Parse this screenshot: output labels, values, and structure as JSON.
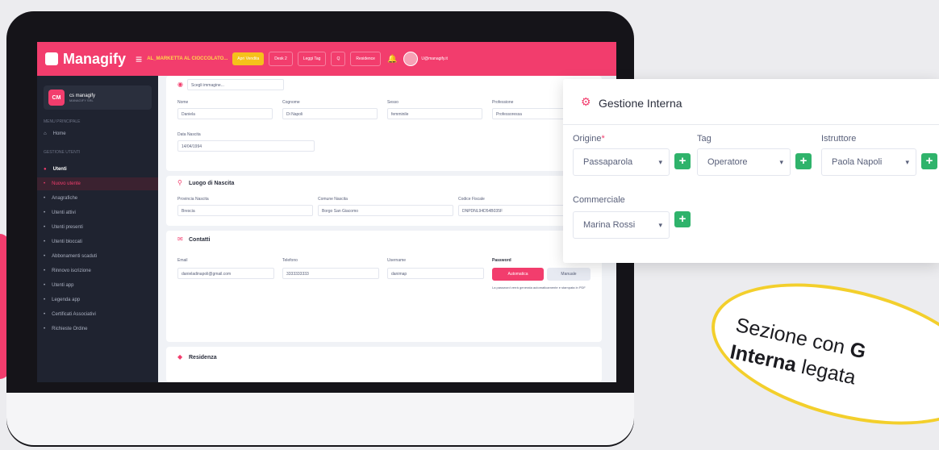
{
  "app": {
    "logo": "Managify",
    "breadcrumb": "AL_MARKETTA AL CIOCCOLATO...",
    "toolbar": [
      "Apri Vendita",
      "Desk 2",
      "Leggi Tag",
      "Q",
      "Residence"
    ],
    "user_label": "U@managify.it"
  },
  "sidebar": {
    "user": {
      "initials": "CM",
      "name": "cs managify",
      "sub": "MANAGIFY SRL"
    },
    "sections": [
      "MENU PRINCIPALE",
      "GESTIONE UTENTI"
    ],
    "home": "Home",
    "group": "Utenti",
    "items": [
      "Nuovo utente",
      "Anagrafiche",
      "Utenti attivi",
      "Utenti presenti",
      "Utenti bloccati",
      "Abbonamenti scaduti",
      "Rinnovo iscrizione",
      "Utenti app",
      "Legenda app",
      "Certificati Associativi",
      "Richieste Ordine"
    ]
  },
  "form": {
    "upload_label": "Scegli immagine...",
    "nome_label": "Nome",
    "nome_value": "Daniela",
    "cognome_label": "Cognome",
    "cognome_value": "Di Napoli",
    "sesso_label": "Sesso",
    "sesso_value": "femminile",
    "professione_label": "Professione",
    "professione_value": "Professoressa",
    "data_label": "Data Nascita",
    "data_value": "14/04/1994",
    "luogo_title": "Luogo di Nascita",
    "provincia_label": "Provincia Nascita",
    "provincia_value": "Brescia",
    "comune_label": "Comune Nascita",
    "comune_value": "Borgo San Giacomo",
    "cf_label": "Codice Fiscale",
    "cf_value": "DNPDNL94D54B035F",
    "contatti_title": "Contatti",
    "email_label": "Email",
    "email_value": "danieladinapoli@gmail.com",
    "telefono_label": "Telefono",
    "telefono_value": "3333333333",
    "username_label": "Username",
    "username_value": "danimap",
    "password_label": "Password",
    "auto_btn": "Automatica",
    "manual_btn": "Manuale",
    "password_note": "La password verrà generata automaticamente e stampata in PDF",
    "residenza_title": "Residenza"
  },
  "panel": {
    "title": "Gestione Interna",
    "origine_label": "Origine",
    "origine_value": "Passaparola",
    "tag_label": "Tag",
    "tag_value": "Operatore",
    "istruttore_label": "Istruttore",
    "istruttore_value": "Paola Napoli",
    "commerciale_label": "Commerciale",
    "commerciale_value": "Marina Rossi"
  },
  "callout": {
    "line1": "Sezione con",
    "line1_cont": "G",
    "line2_bold": "Interna",
    "line2_rest": "legata"
  },
  "colors": {
    "accent": "#f23d6d",
    "success": "#2fb36b",
    "highlight": "#f3cf2c",
    "sidebar": "#1f2330"
  }
}
